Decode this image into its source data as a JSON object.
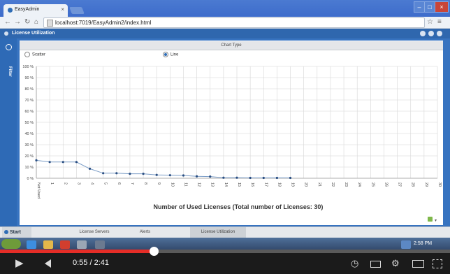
{
  "browser": {
    "tab_title": "EasyAdmin",
    "tab_close": "×",
    "url": "localhost:7019/EasyAdmin2/index.html",
    "window_buttons": [
      "–",
      "□",
      "×"
    ]
  },
  "app": {
    "panel_title": "License Utilization",
    "sidebar_label": "Filter",
    "chart_type_header": "Chart Type",
    "chart_type_options": [
      {
        "label": "Scatter",
        "selected": false
      },
      {
        "label": "Line",
        "selected": true
      }
    ],
    "bottom_tabs": [
      {
        "label": "License Servers",
        "active": false
      },
      {
        "label": "Alerts",
        "active": false
      },
      {
        "label": "License Utilization",
        "active": true
      }
    ],
    "start_label": "Start"
  },
  "chart_data": {
    "type": "line",
    "categories": [
      "Not Used",
      "1",
      "2",
      "3",
      "4",
      "5",
      "6",
      "7",
      "8",
      "9",
      "10",
      "11",
      "12",
      "13",
      "14",
      "15",
      "16",
      "17",
      "18",
      "19",
      "20",
      "21",
      "22",
      "23",
      "24",
      "25",
      "26",
      "27",
      "28",
      "29",
      "30"
    ],
    "values": [
      16,
      14.5,
      14.5,
      14.5,
      8.5,
      4.5,
      4.5,
      4,
      4,
      3,
      2.7,
      2.5,
      1.7,
      1.5,
      0.5,
      0.5,
      0.3,
      0.3,
      0.3,
      0.3
    ],
    "yticks": [
      "0 %",
      "10 %",
      "20 %",
      "30 %",
      "40 %",
      "50 %",
      "60 %",
      "70 %",
      "80 %",
      "90 %",
      "100 %"
    ],
    "ylim": [
      0,
      100
    ],
    "xlabel": "Number of Used Licenses (Total number of Licenses: 30)",
    "grid": true,
    "line_color": "#7a9cc6",
    "marker_color": "#2b4f83"
  },
  "taskbar": {
    "clock": "2:58 PM"
  },
  "video": {
    "current_time": "0:55",
    "separator": "/",
    "duration": "2:41",
    "progress_fraction": 0.342,
    "time_display": "0:55 / 2:41"
  }
}
